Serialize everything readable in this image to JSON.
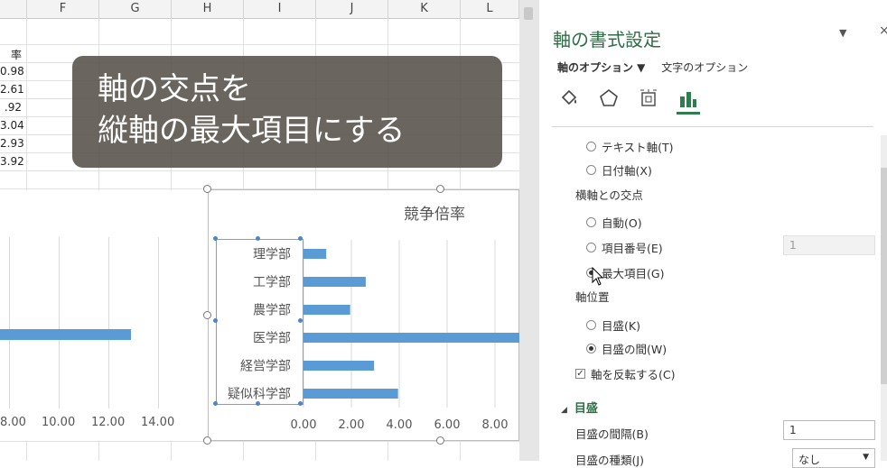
{
  "spreadsheet": {
    "columns": [
      "F",
      "G",
      "H",
      "I",
      "J",
      "K",
      "L"
    ],
    "partial_header": "率",
    "cell_values": [
      "0.98",
      "2.61",
      ".92",
      "3.04",
      "2.93",
      "3.92"
    ]
  },
  "left_chart": {
    "x_ticks": [
      "8.00",
      "10.00",
      "12.00",
      "14.00"
    ]
  },
  "chart_data": {
    "type": "bar",
    "orientation": "horizontal",
    "title": "競争倍率",
    "categories": [
      "理学部",
      "工学部",
      "農学部",
      "医学部",
      "経営学部",
      "疑似科学部"
    ],
    "values": [
      0.95,
      2.6,
      1.95,
      12.9,
      2.95,
      3.95
    ],
    "x_ticks": [
      "0.00",
      "2.00",
      "4.00",
      "6.00",
      "8.00"
    ],
    "xlim": [
      0,
      9
    ],
    "grid": true,
    "colors": {
      "bar": "#5b9bd5"
    }
  },
  "overlay": {
    "line1": "軸の交点を",
    "line2": "縦軸の最大項目にする"
  },
  "pane": {
    "title": "軸の書式設定",
    "close_glyph": "×",
    "dropdown_glyph": "▼",
    "tab_axis_options": "軸のオプション ▼",
    "tab_text_options": "文字のオプション",
    "icons": [
      "fill-line-icon",
      "effects-pentagon-icon",
      "size-properties-icon",
      "axis-options-bar-icon"
    ],
    "opt_text_axis": "テキスト軸(T)",
    "opt_date_axis": "日付軸(X)",
    "crosses_header": "横軸との交点",
    "opt_auto": "自動(O)",
    "opt_category_number": "項目番号(E)",
    "category_number_value": "1",
    "opt_max_category": "最大項目(G)",
    "position_header": "軸位置",
    "opt_on_tick": "目盛(K)",
    "opt_between_ticks": "目盛の間(W)",
    "reverse_label": "軸を反転する(C)",
    "ticks_section": "目盛",
    "interval_label": "目盛の間隔(B)",
    "interval_value": "1",
    "type_label": "目盛の種類(J)",
    "type_value": "なし"
  }
}
